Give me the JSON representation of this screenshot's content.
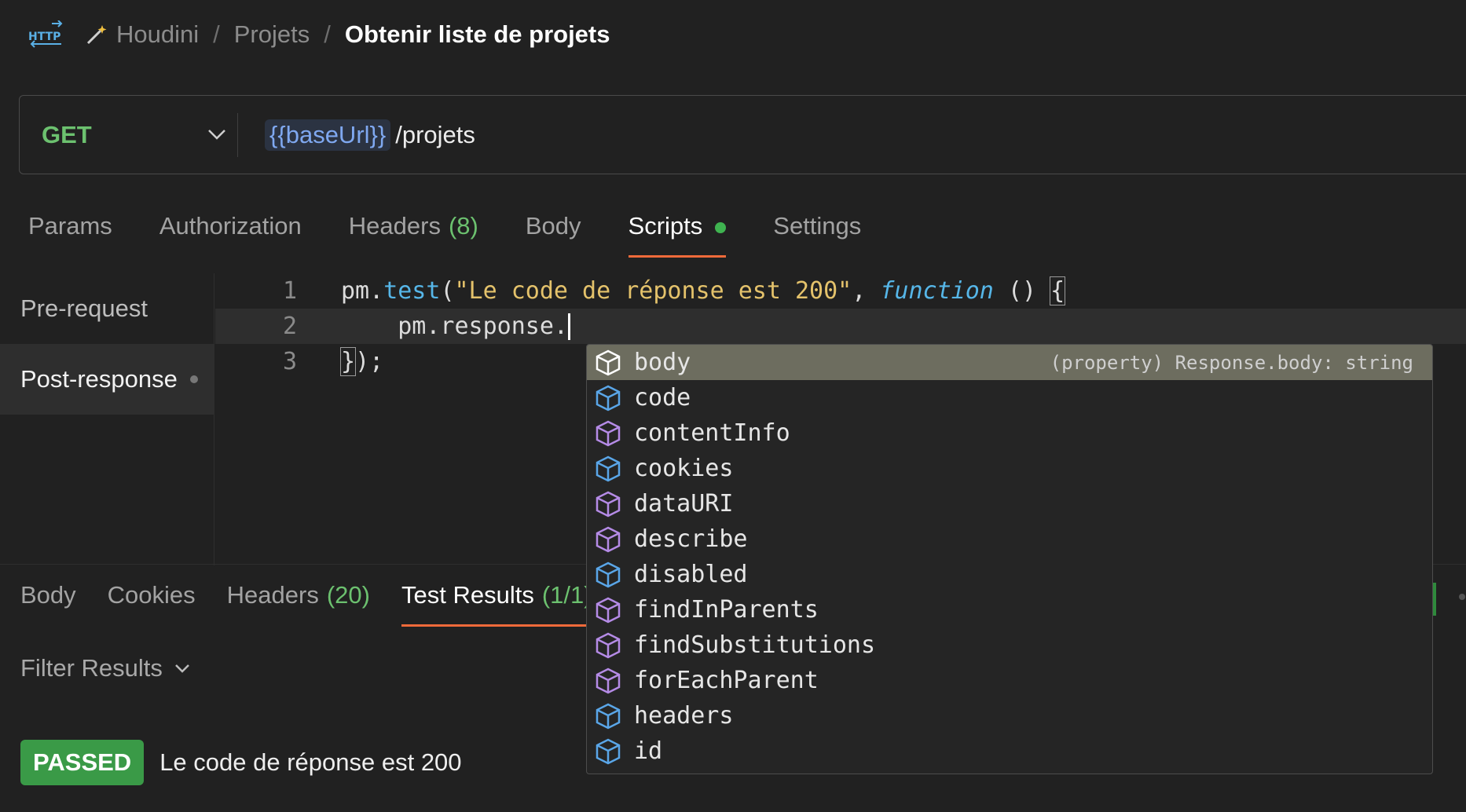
{
  "breadcrumb": {
    "http_icon": "http-icon",
    "wand_icon": "magic-wand-icon",
    "workspace": "Houdini",
    "collection": "Projets",
    "request": "Obtenir liste de projets",
    "separator": "/"
  },
  "url_bar": {
    "method": "GET",
    "variable": "{{baseUrl}}",
    "path": "/projets"
  },
  "request_tabs": [
    {
      "label": "Params",
      "count": ""
    },
    {
      "label": "Authorization",
      "count": ""
    },
    {
      "label": "Headers",
      "count": "(8)"
    },
    {
      "label": "Body",
      "count": ""
    },
    {
      "label": "Scripts",
      "count": ""
    },
    {
      "label": "Settings",
      "count": ""
    }
  ],
  "scripts_panel": {
    "items": [
      "Pre-request",
      "Post-response"
    ],
    "active": "Post-response"
  },
  "editor": {
    "line_numbers": [
      "1",
      "2",
      "3"
    ],
    "line1": {
      "obj": "pm.",
      "fn": "test",
      "open": "(",
      "string": "\"Le code de réponse est 200\"",
      "comma": ", ",
      "keyword": "function",
      "tail": " () ",
      "brace": "{"
    },
    "line2": "    pm.response.",
    "line3": {
      "brace": "}",
      "tail": ");"
    }
  },
  "autocomplete": {
    "items": [
      {
        "label": "body",
        "icon": "property-icon",
        "color": "#ffffff",
        "detail": "(property) Response.body: string"
      },
      {
        "label": "code",
        "icon": "property-icon",
        "color": "#5aa6e8",
        "detail": ""
      },
      {
        "label": "contentInfo",
        "icon": "method-icon",
        "color": "#b58be6",
        "detail": ""
      },
      {
        "label": "cookies",
        "icon": "property-icon",
        "color": "#5aa6e8",
        "detail": ""
      },
      {
        "label": "dataURI",
        "icon": "method-icon",
        "color": "#b58be6",
        "detail": ""
      },
      {
        "label": "describe",
        "icon": "method-icon",
        "color": "#b58be6",
        "detail": ""
      },
      {
        "label": "disabled",
        "icon": "property-icon",
        "color": "#5aa6e8",
        "detail": ""
      },
      {
        "label": "findInParents",
        "icon": "method-icon",
        "color": "#b58be6",
        "detail": ""
      },
      {
        "label": "findSubstitutions",
        "icon": "method-icon",
        "color": "#b58be6",
        "detail": ""
      },
      {
        "label": "forEachParent",
        "icon": "method-icon",
        "color": "#b58be6",
        "detail": ""
      },
      {
        "label": "headers",
        "icon": "property-icon",
        "color": "#5aa6e8",
        "detail": ""
      },
      {
        "label": "id",
        "icon": "property-icon",
        "color": "#5aa6e8",
        "detail": ""
      }
    ]
  },
  "response_tabs": [
    {
      "label": "Body",
      "count": ""
    },
    {
      "label": "Cookies",
      "count": ""
    },
    {
      "label": "Headers",
      "count": "(20)"
    },
    {
      "label": "Test Results",
      "count": "(1/1)"
    }
  ],
  "filter": {
    "label": "Filter Results"
  },
  "test_result": {
    "status": "PASSED",
    "name": "Le code de réponse est 200"
  },
  "colors": {
    "accent": "#f06a3a",
    "success": "#3a9a47",
    "method_get": "#6cc16f"
  }
}
